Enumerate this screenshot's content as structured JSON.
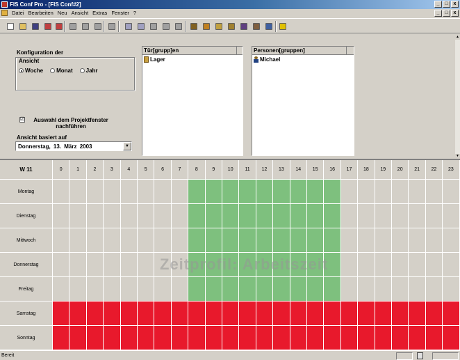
{
  "window": {
    "title": "FIS Conf Pro - [FIS Conf#2]",
    "controls": [
      "_",
      "□",
      "x"
    ],
    "mdi_controls": [
      "_",
      "□",
      "x"
    ]
  },
  "menu": [
    "Datei",
    "Bearbeiten",
    "Neu",
    "Ansicht",
    "Extras",
    "Fenster",
    "?"
  ],
  "toolbar_icons": [
    "new-icon",
    "open-icon",
    "save-icon",
    "print-icon",
    "print-preview-icon",
    "cut-icon",
    "copy-icon",
    "paste-icon",
    "find-icon",
    "calendar-icon",
    "list-icon",
    "transfer-icon",
    "delete-icon",
    "properties-icon",
    "person-icon",
    "key-icon",
    "door-icon",
    "door-group-icon",
    "reader-icon",
    "terminal-icon",
    "search-icon",
    "help-icon"
  ],
  "config": {
    "title": "Konfiguration der",
    "view_group_label": "Ansicht",
    "view_options": [
      {
        "label": "Woche",
        "selected": true
      },
      {
        "label": "Monat",
        "selected": false
      },
      {
        "label": "Jahr",
        "selected": false
      }
    ],
    "follow_checkbox": {
      "label": "Auswahl dem Projektfenster nachführen",
      "checked": true,
      "mark": "☑"
    },
    "based_on_label": "Ansicht basiert auf",
    "date_value": "Donnerstag, 13.   März   2003"
  },
  "door_groups": {
    "header": "Tür[grupp]en",
    "items": [
      "Lager"
    ]
  },
  "person_groups": {
    "header": "Personen[gruppen]",
    "items": [
      "Michael"
    ]
  },
  "schedule": {
    "week_label": "W 11",
    "hours": [
      "0",
      "1",
      "2",
      "3",
      "4",
      "5",
      "6",
      "7",
      "8",
      "9",
      "10",
      "11",
      "12",
      "13",
      "14",
      "15",
      "16",
      "17",
      "18",
      "19",
      "20",
      "21",
      "22",
      "23"
    ],
    "days": [
      {
        "name": "Montag",
        "type": "weekday"
      },
      {
        "name": "Dienstag",
        "type": "weekday"
      },
      {
        "name": "Mittwoch",
        "type": "weekday"
      },
      {
        "name": "Donnerstag",
        "type": "weekday"
      },
      {
        "name": "Freitag",
        "type": "weekday"
      },
      {
        "name": "Samstag",
        "type": "closed"
      },
      {
        "name": "Sonntag",
        "type": "closed"
      }
    ],
    "work_hours": [
      8,
      16
    ],
    "watermark": "Zeitprofil: Arbeitszeit",
    "colors": {
      "work": "#7ec07e",
      "closed": "#e8192c",
      "none": "#d4d0c8"
    }
  },
  "status": {
    "text": "Bereit"
  }
}
